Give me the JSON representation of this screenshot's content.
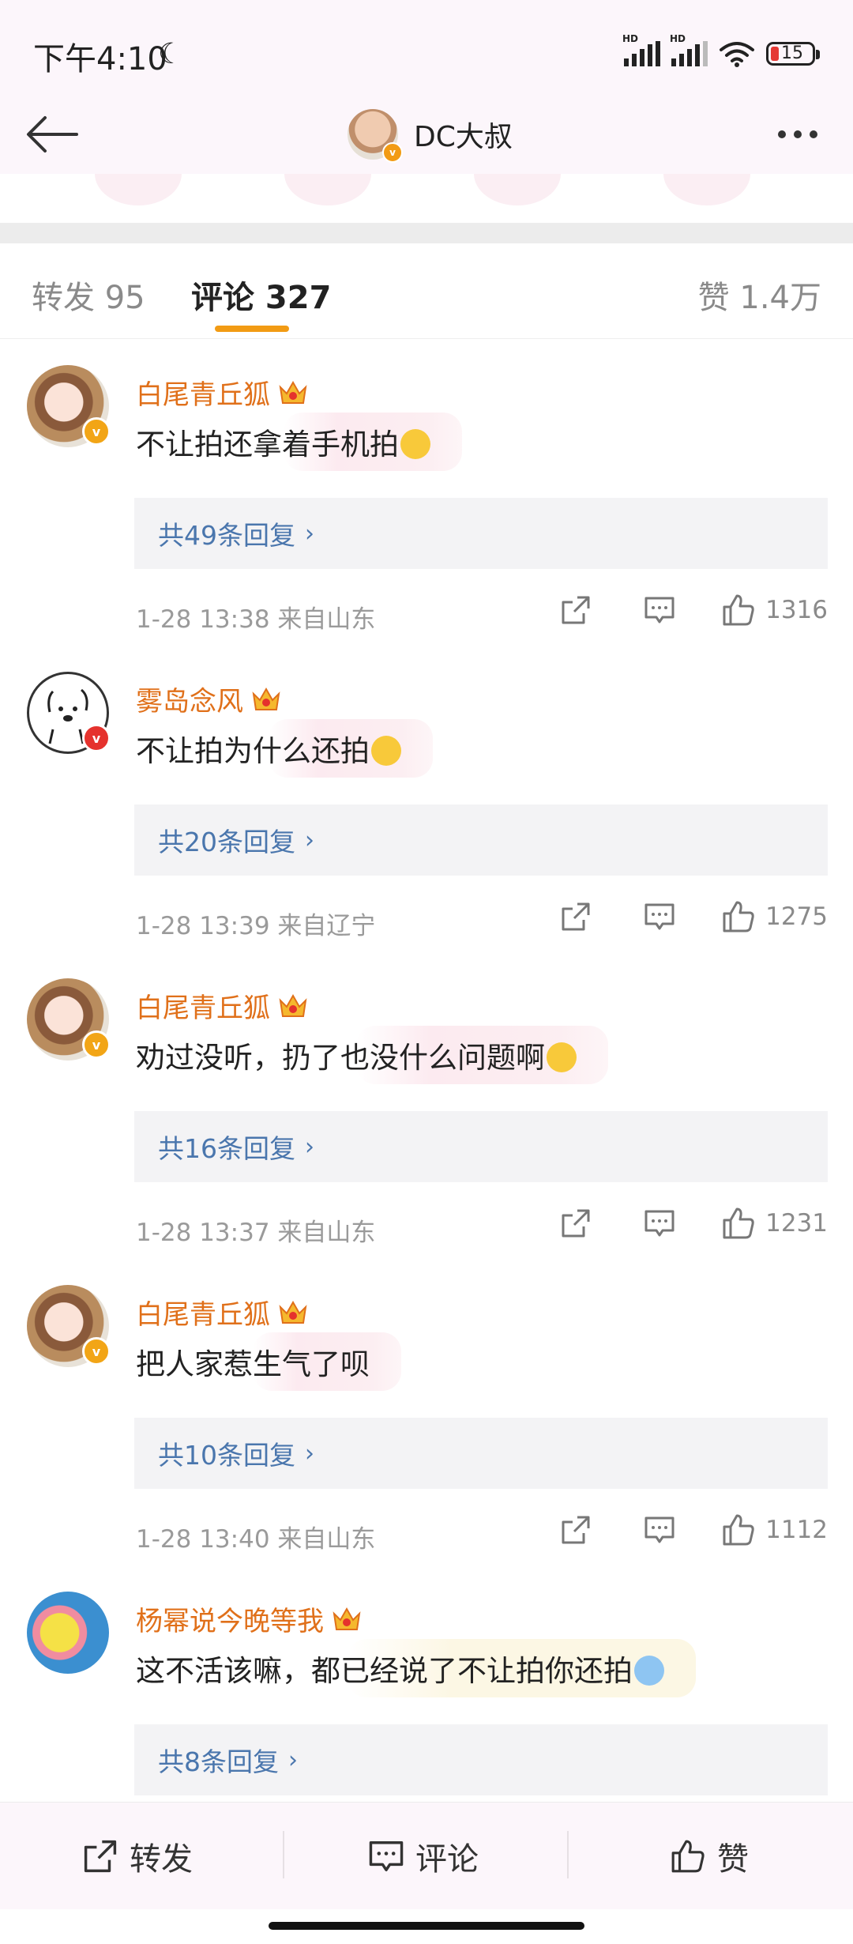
{
  "status_bar": {
    "time": "下午4:10",
    "battery": "15"
  },
  "header": {
    "title": "DC大叔"
  },
  "tabs": {
    "repost": "转发 95",
    "comment": "评论 327",
    "like": "赞 1.4万"
  },
  "colors": {
    "accent": "#f29b14",
    "name": "#e0701a",
    "link": "#4a76ad"
  },
  "comments": [
    {
      "name": "白尾青丘狐",
      "text": "不让拍还拿着手机拍",
      "replies": "共49条回复",
      "meta": "1-28 13:38  来自山东",
      "likes": "1316"
    },
    {
      "name": "雾岛念风",
      "text": "不让拍为什么还拍",
      "replies": "共20条回复",
      "meta": "1-28 13:39  来自辽宁",
      "likes": "1275"
    },
    {
      "name": "白尾青丘狐",
      "text": "劝过没听，扔了也没什么问题啊",
      "replies": "共16条回复",
      "meta": "1-28 13:37  来自山东",
      "likes": "1231"
    },
    {
      "name": "白尾青丘狐",
      "text": "把人家惹生气了呗",
      "replies": "共10条回复",
      "meta": "1-28 13:40  来自山东",
      "likes": "1112"
    },
    {
      "name": "杨幂说今晚等我",
      "text": "这不活该嘛，都已经说了不让拍你还拍",
      "replies": "共8条回复"
    }
  ],
  "bottom_bar": {
    "repost": "转发",
    "comment": "评论",
    "like": "赞"
  }
}
